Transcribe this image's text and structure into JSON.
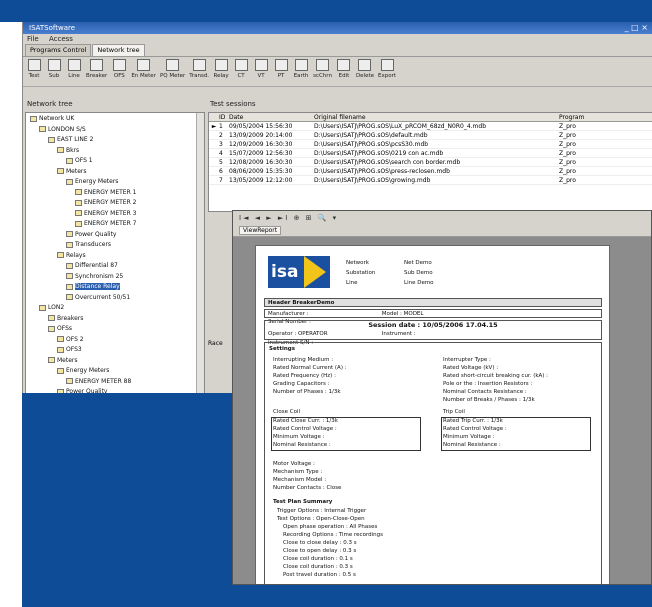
{
  "window": {
    "title": "ISATSoftware",
    "controls": "_ □ ×"
  },
  "menu": [
    "File",
    "Access"
  ],
  "tabs": [
    {
      "label": "Programs Control"
    },
    {
      "label": "Network tree"
    }
  ],
  "toolbar": [
    {
      "label": "Test",
      "icon": "pencil-icon"
    },
    {
      "label": "Sub",
      "icon": "substation-icon"
    },
    {
      "label": "Line",
      "icon": "line-icon"
    },
    {
      "label": "Breaker",
      "icon": "breaker-icon"
    },
    {
      "label": "OFS",
      "icon": "ofs-icon"
    },
    {
      "label": "En Meter",
      "icon": "energy-meter-icon"
    },
    {
      "label": "PQ Meter",
      "icon": "pq-meter-icon"
    },
    {
      "label": "Transd.",
      "icon": "transducer-icon"
    },
    {
      "label": "Relay",
      "icon": "relay-icon"
    },
    {
      "label": "CT",
      "icon": "ct-icon"
    },
    {
      "label": "VT",
      "icon": "vt-icon"
    },
    {
      "label": "PT",
      "icon": "pt-icon"
    },
    {
      "label": "Earth",
      "icon": "earth-icon"
    },
    {
      "label": "scChrn",
      "icon": "sc-icon"
    },
    {
      "label": "Edit",
      "icon": "edit-icon"
    },
    {
      "label": "Delete",
      "icon": "delete-icon"
    },
    {
      "label": "Export",
      "icon": "export-icon"
    }
  ],
  "network_tree": {
    "header": "Network tree",
    "nodes": [
      {
        "label": "Network UK"
      },
      {
        "label": "LONDON S/S"
      },
      {
        "label": "EAST LINE 2"
      },
      {
        "label": "Bkrs"
      },
      {
        "label": "OFS 1"
      },
      {
        "label": "Meters"
      },
      {
        "label": "Energy Meters"
      },
      {
        "label": "ENERGY METER 1"
      },
      {
        "label": "ENERGY METER 2"
      },
      {
        "label": "ENERGY METER 3"
      },
      {
        "label": "ENERGY METER 7"
      },
      {
        "label": "Power Quality"
      },
      {
        "label": "Transducers"
      },
      {
        "label": "Relays"
      },
      {
        "label": "Differential 87"
      },
      {
        "label": "Synchronism 25"
      },
      {
        "label": "Distance Relay"
      },
      {
        "label": "Overcurrent 50/51"
      },
      {
        "label": "LON2"
      },
      {
        "label": "Breakers"
      },
      {
        "label": "OFSs"
      },
      {
        "label": "OFS 2"
      },
      {
        "label": "OFS3"
      },
      {
        "label": "Meters"
      },
      {
        "label": "Energy Meters"
      },
      {
        "label": "ENERGY METER 88"
      },
      {
        "label": "Power Quality"
      }
    ]
  },
  "test_sessions": {
    "header": "Test sessions",
    "columns": [
      "ID",
      "Date",
      "Original filename",
      "Program"
    ],
    "rows": [
      {
        "id": "1",
        "date": "09/05/2004 15:56:30",
        "file": "D:\\Users\\ISATJ\\PROG.sOS\\LuX_pRCOM_68zd_N0R0_4.mdb",
        "prog": "Z_pro",
        "mark": "►"
      },
      {
        "id": "2",
        "date": "13/09/2009 20:14:00",
        "file": "D:\\Users\\ISATJ\\PROG.sOS\\default.mdb",
        "prog": "Z_pro",
        "mark": ""
      },
      {
        "id": "3",
        "date": "12/09/2009 16:30:30",
        "file": "D:\\Users\\ISATJ\\PROG.sOS\\pcsS30.mdb",
        "prog": "Z_pro",
        "mark": ""
      },
      {
        "id": "4",
        "date": "15/07/2009 12:56:30",
        "file": "D:\\Users\\ISATJ\\PROG.sOS\\0219 con ac.mdb",
        "prog": "Z_pro",
        "mark": ""
      },
      {
        "id": "5",
        "date": "12/08/2009 16:30:30",
        "file": "D:\\Users\\ISATJ\\PROG.sOS\\search con border.mdb",
        "prog": "Z_pro",
        "mark": ""
      },
      {
        "id": "6",
        "date": "08/06/2009 15:35:30",
        "file": "D:\\Users\\ISATJ\\PROG.sOS\\press-reclosen.mdb",
        "prog": "Z_pro",
        "mark": ""
      },
      {
        "id": "7",
        "date": "13/05/2009 12:12:00",
        "file": "D:\\Users\\ISATJ\\PROG.sOS\\growing.mdb",
        "prog": "Z_pro",
        "mark": ""
      }
    ]
  },
  "lower_label": "Race",
  "viewer": {
    "toolbar": "I◄ ◄ ► ►I  ⊕  ⊞  🔍 ▾",
    "tab": "ViewReport"
  },
  "report": {
    "logo": "isa",
    "header_fields": [
      {
        "k": "Network",
        "v": "Net Demo"
      },
      {
        "k": "Substation",
        "v": "Sub Demo"
      },
      {
        "k": "Line",
        "v": "Line Demo"
      }
    ],
    "title": "Header BreakerDemo",
    "meta": [
      "Manufacturer :",
      "Model : MODEL",
      "Serial Number :"
    ],
    "session": "Session date : 10/05/2006 17.04.15",
    "operator": [
      "Operator : OPERATOR",
      "Instrument :",
      "Instrument S/N :"
    ],
    "settings_title": "Settings",
    "settings_left": [
      "Interrupting Medium :",
      "Rated Normal Current (A) :",
      "Rated Frequency (Hz) :",
      "Grading Capacitors :",
      "Number of Phases : 1/3k"
    ],
    "settings_right": [
      "Interrupter Type :",
      "Rated Voltage (kV) :",
      "Rated short-circuit breaking cur. (kA) :",
      "Pole or the : Insertion Resistors :",
      "Nominal Contacts Resistance :",
      "Number of Breaks / Phases : 1/3k"
    ],
    "close_coil_title": "Close Coil",
    "close_coil": [
      "Rated Close Curr. : 1/3k",
      "Rated Control Voltage :",
      "Minimum Voltage :",
      "Nominal Resistance :"
    ],
    "trip_coil_title": "Trip Coil",
    "trip_coil": [
      "Rated Trip Curr. : 1/3k",
      "Rated Control Voltage :",
      "Minimum Voltage :",
      "Nominal Resistance :"
    ],
    "misc": [
      "Motor Voltage :",
      "Mechanism Type :",
      "Mechanism Model :",
      "Number Contacts : Close"
    ],
    "summary_title": "Test Plan Summary",
    "summary": [
      "Trigger Options : Internal Trigger",
      "Test Options : Open-Close-Open",
      "Open phase operation : All Phases",
      "Recording Options : Time recordings",
      "Close to close delay : 0.3 s",
      "Close to open delay : 0.3 s",
      "Close coil duration : 0.1 s",
      "Close coil duration : 0.3 s",
      "Post travel duration : 0.5 s"
    ]
  }
}
